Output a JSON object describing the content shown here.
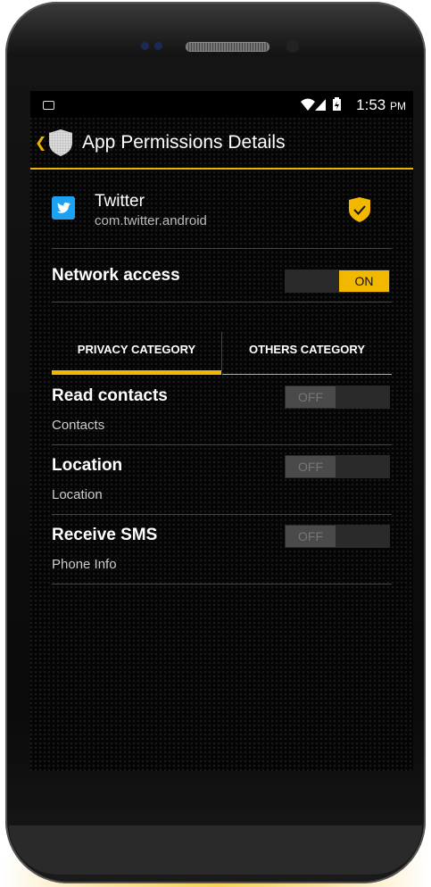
{
  "status_bar": {
    "time": "1:53",
    "ampm": "PM"
  },
  "action_bar": {
    "title": "App Permissions Details"
  },
  "app": {
    "name": "Twitter",
    "package": "com.twitter.android"
  },
  "network": {
    "label": "Network access",
    "toggle": "ON"
  },
  "tabs": [
    {
      "label": "PRIVACY CATEGORY",
      "selected": true
    },
    {
      "label": "OTHERS CATEGORY",
      "selected": false
    }
  ],
  "permissions": [
    {
      "name": "Read contacts",
      "category": "Contacts",
      "toggle": "OFF"
    },
    {
      "name": "Location",
      "category": "Location",
      "toggle": "OFF"
    },
    {
      "name": "Receive SMS",
      "category": "Phone Info",
      "toggle": "OFF"
    }
  ],
  "colors": {
    "accent": "#f2b800",
    "twitter": "#1da1f2"
  }
}
